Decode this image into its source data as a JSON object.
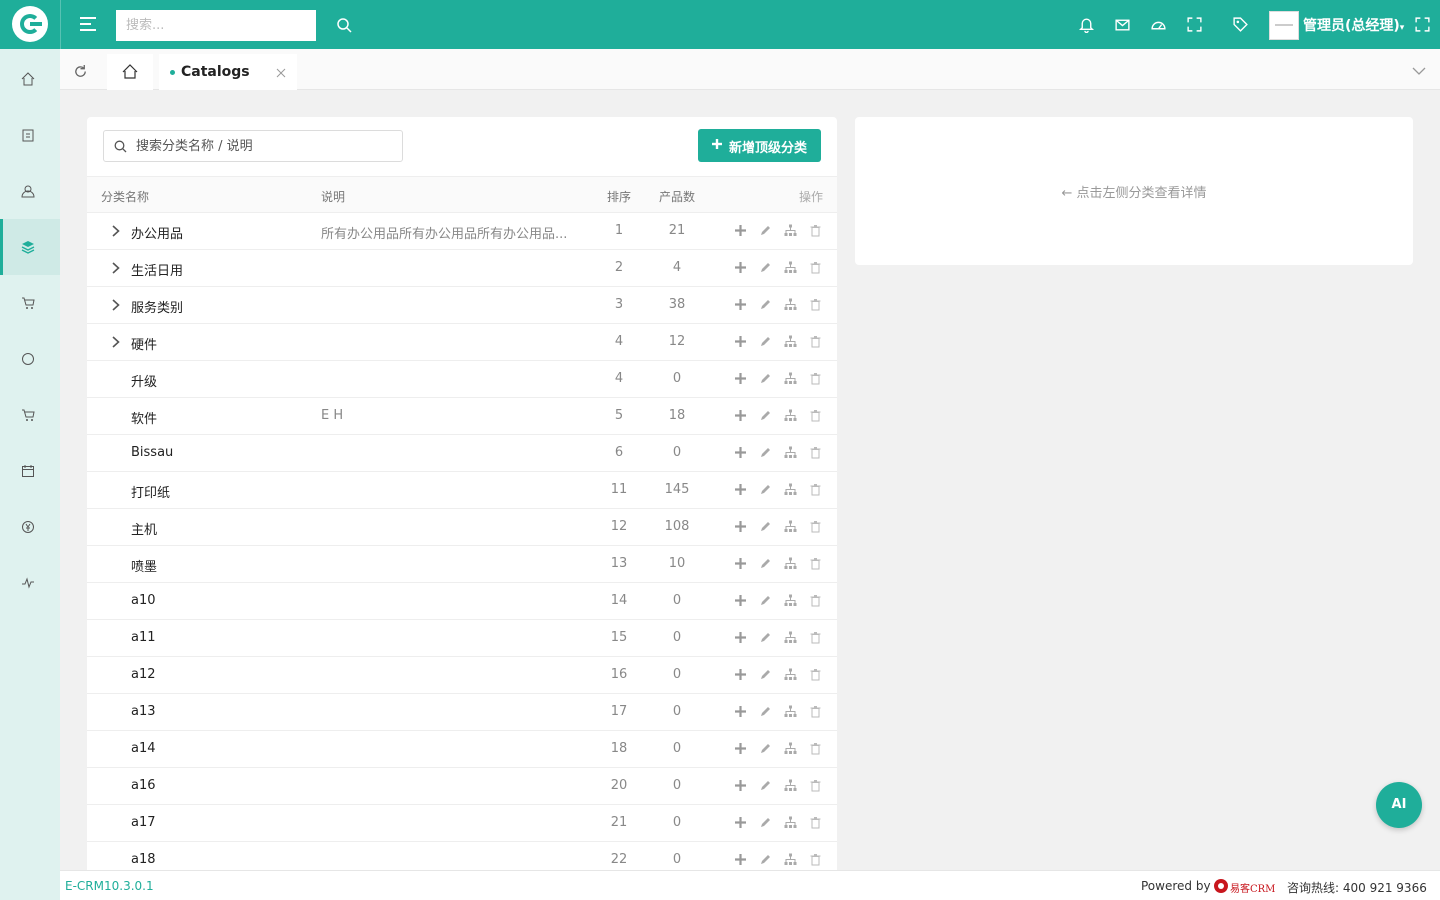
{
  "topbar": {
    "search_placeholder": "搜索...",
    "user_name": "管理员(总经理)"
  },
  "tabs": {
    "active_label": "Catalogs"
  },
  "catalog": {
    "search_placeholder": "搜索分类名称 / 说明",
    "add_button_label": "新增顶级分类",
    "columns": {
      "name": "分类名称",
      "desc": "说明",
      "sort": "排序",
      "count": "产品数",
      "actions": "操作"
    },
    "rows": [
      {
        "name": "办公用品",
        "desc": "所有办公用品所有办公用品所有办公用品...",
        "sort": "1",
        "count": "21",
        "expandable": true
      },
      {
        "name": "生活日用",
        "desc": "",
        "sort": "2",
        "count": "4",
        "expandable": true
      },
      {
        "name": "服务类别",
        "desc": "",
        "sort": "3",
        "count": "38",
        "expandable": true
      },
      {
        "name": "硬件",
        "desc": "",
        "sort": "4",
        "count": "12",
        "expandable": true
      },
      {
        "name": "升级",
        "desc": "",
        "sort": "4",
        "count": "0",
        "expandable": false
      },
      {
        "name": "软件",
        "desc": "E H",
        "sort": "5",
        "count": "18",
        "expandable": false
      },
      {
        "name": "Bissau",
        "desc": "",
        "sort": "6",
        "count": "0",
        "expandable": false
      },
      {
        "name": "打印纸",
        "desc": "",
        "sort": "11",
        "count": "145",
        "expandable": false
      },
      {
        "name": "主机",
        "desc": "",
        "sort": "12",
        "count": "108",
        "expandable": false
      },
      {
        "name": "喷墨",
        "desc": "",
        "sort": "13",
        "count": "10",
        "expandable": false
      },
      {
        "name": "a10",
        "desc": "",
        "sort": "14",
        "count": "0",
        "expandable": false
      },
      {
        "name": "a11",
        "desc": "",
        "sort": "15",
        "count": "0",
        "expandable": false
      },
      {
        "name": "a12",
        "desc": "",
        "sort": "16",
        "count": "0",
        "expandable": false
      },
      {
        "name": "a13",
        "desc": "",
        "sort": "17",
        "count": "0",
        "expandable": false
      },
      {
        "name": "a14",
        "desc": "",
        "sort": "18",
        "count": "0",
        "expandable": false
      },
      {
        "name": "a16",
        "desc": "",
        "sort": "20",
        "count": "0",
        "expandable": false
      },
      {
        "name": "a17",
        "desc": "",
        "sort": "21",
        "count": "0",
        "expandable": false
      },
      {
        "name": "a18",
        "desc": "",
        "sort": "22",
        "count": "0",
        "expandable": false
      }
    ]
  },
  "detail": {
    "hint": "← 点击左侧分类查看详情"
  },
  "footer": {
    "version": "E-CRM10.3.0.1",
    "powered_by": "Powered by",
    "brand": "易客CRM",
    "hotline": "咨询热线: 400 921 9366"
  },
  "ai_button_label": "AI",
  "colors": {
    "primary": "#1fae9a",
    "sidebar_bg": "#dff2ef",
    "brand_red": "#c8161d"
  },
  "icons": {
    "sidebar": [
      "home-icon",
      "clipboard-icon",
      "contacts-icon",
      "layers-icon",
      "cart-icon",
      "circle-icon",
      "cart-icon",
      "calendar-icon",
      "yen-icon",
      "activity-icon"
    ],
    "row_actions": [
      "plus-icon",
      "pencil-icon",
      "hierarchy-icon",
      "trash-icon"
    ]
  }
}
